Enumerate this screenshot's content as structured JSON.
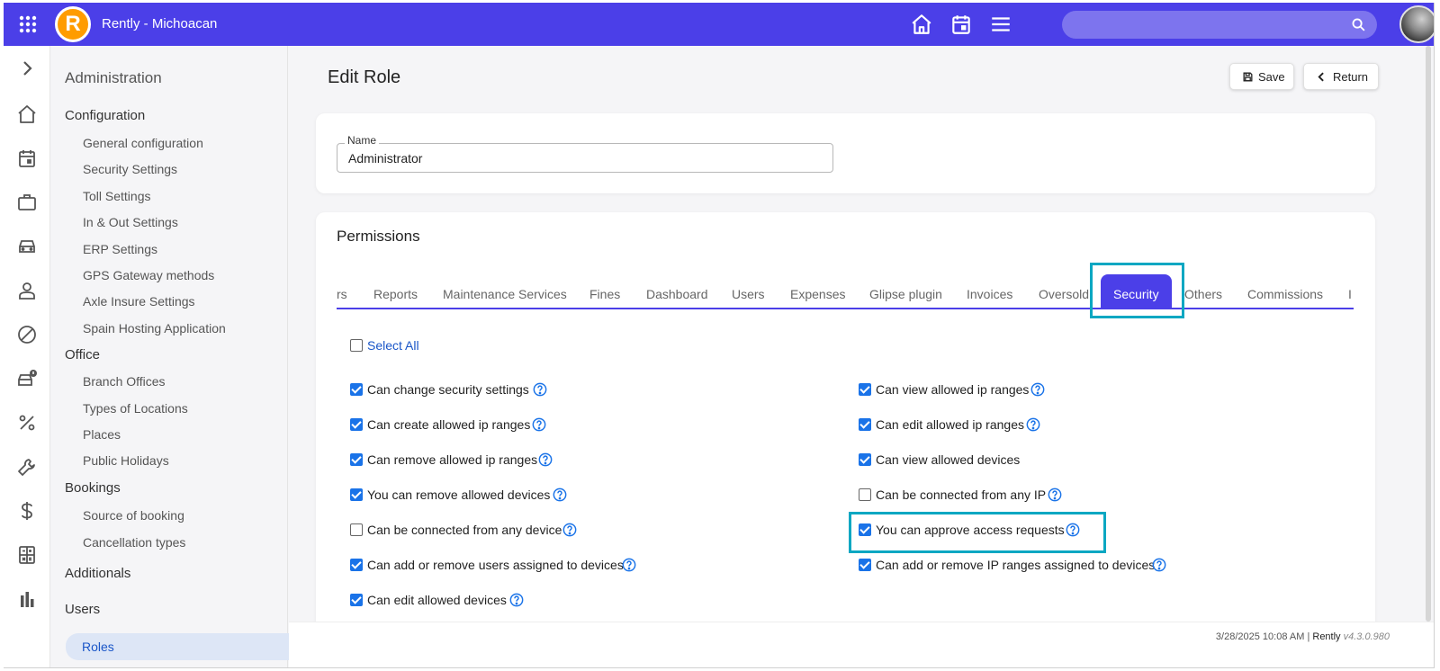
{
  "header": {
    "app_title": "Rently - Michoacan",
    "logo_letter": "R",
    "search_placeholder": ""
  },
  "colors": {
    "primary": "#4b3fe8",
    "logo": "#ff9c00",
    "highlight": "#0aa7c2",
    "checkbox": "#1a73e8",
    "link": "#1a56c8"
  },
  "rail_icons": [
    "chevron-right-icon",
    "home-icon",
    "calendar-icon",
    "briefcase-icon",
    "car-icon",
    "person-icon",
    "blocked-icon",
    "car-alert-icon",
    "percent-icon",
    "wrench-icon",
    "dollar-icon",
    "calculator-icon",
    "bar-chart-icon"
  ],
  "sidebar": {
    "title": "Administration",
    "groups": {
      "configuration": "Configuration",
      "office": "Office",
      "bookings": "Bookings",
      "additionals": "Additionals",
      "users": "Users"
    },
    "configuration_items": [
      "General configuration",
      "Security Settings",
      "Toll Settings",
      "In & Out Settings",
      "ERP Settings",
      "GPS Gateway methods",
      "Axle Insure Settings",
      "Spain Hosting Application"
    ],
    "office_items": [
      "Branch Offices",
      "Types of Locations",
      "Places",
      "Public Holidays"
    ],
    "bookings_items": [
      "Source of booking",
      "Cancellation types"
    ],
    "active_item": "Roles"
  },
  "page": {
    "title": "Edit Role",
    "save_label": "Save",
    "return_label": "Return"
  },
  "name_field": {
    "label": "Name",
    "value": "Administrator"
  },
  "permissions": {
    "title": "Permissions",
    "tabs": [
      "rs",
      "Reports",
      "Maintenance Services",
      "Fines",
      "Dashboard",
      "Users",
      "Expenses",
      "Glipse plugin",
      "Invoices",
      "Oversold",
      "Security",
      "Others",
      "Commissions",
      "I"
    ],
    "active_tab": "Security",
    "select_all": "Select All",
    "left_column": [
      {
        "label": "Can change security settings",
        "checked": true
      },
      {
        "label": "Can create allowed ip ranges",
        "checked": true
      },
      {
        "label": "Can remove allowed ip ranges",
        "checked": true
      },
      {
        "label": "You can remove allowed devices",
        "checked": true
      },
      {
        "label": "Can be connected from any device",
        "checked": false
      },
      {
        "label": "Can add or remove users assigned to devices",
        "checked": true
      },
      {
        "label": "Can edit allowed devices",
        "checked": true
      }
    ],
    "right_column": [
      {
        "label": "Can view allowed ip ranges",
        "checked": true
      },
      {
        "label": "Can edit allowed ip ranges",
        "checked": true
      },
      {
        "label": "Can view allowed devices",
        "checked": true
      },
      {
        "label": "Can be connected from any IP",
        "checked": false
      },
      {
        "label": "You can approve access requests",
        "checked": true
      },
      {
        "label": "Can add or remove IP ranges assigned to devices",
        "checked": true
      }
    ]
  },
  "footer": {
    "datetime": "3/28/2025 10:08 AM",
    "separator": "|",
    "brand": "Rently",
    "version": "v4.3.0.980"
  }
}
